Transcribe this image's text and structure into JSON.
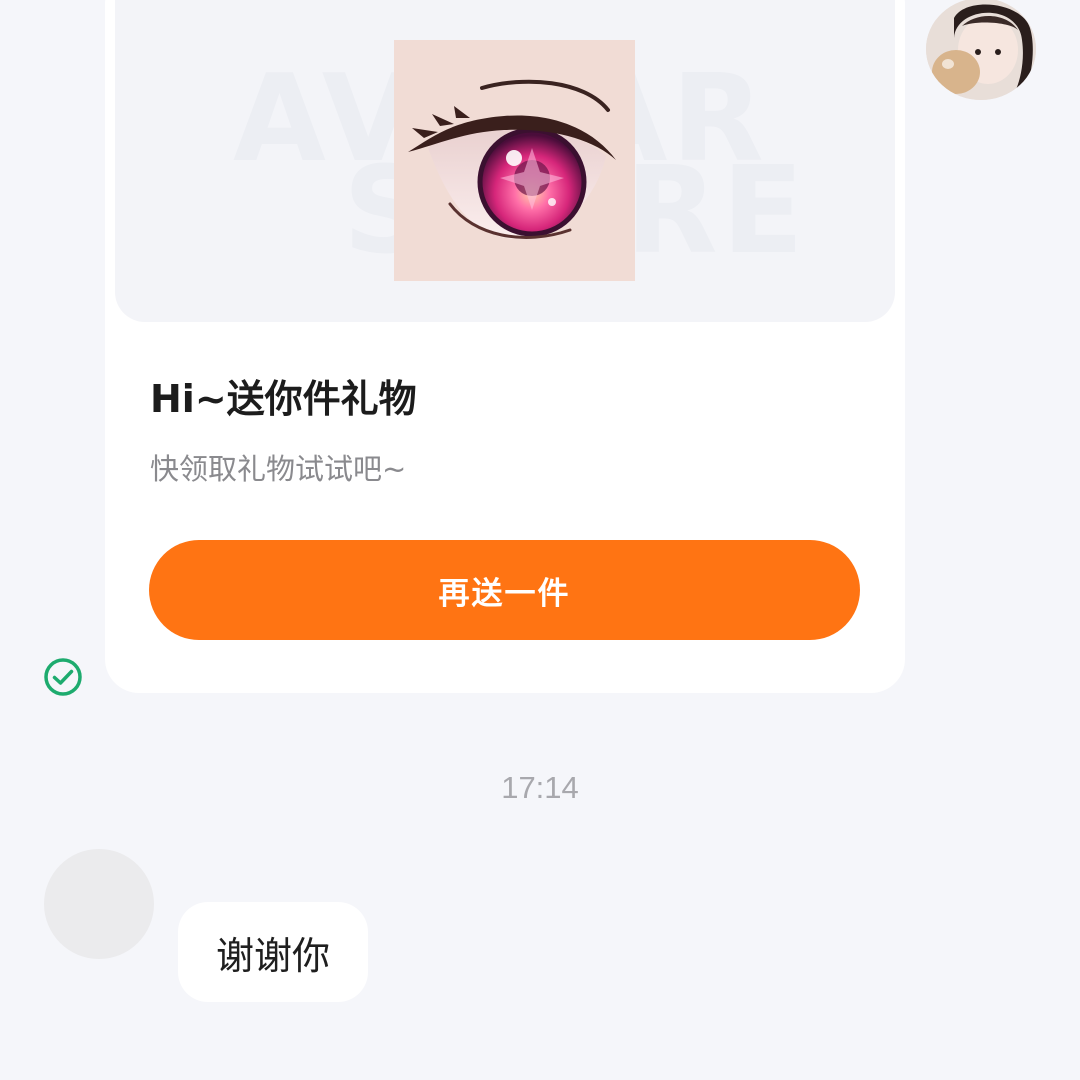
{
  "gift_card": {
    "watermark_line1": "AVATAR",
    "watermark_line2": "STORE",
    "image_icon": "anime-eye-icon",
    "title": "Hi~送你件礼物",
    "subtitle": "快领取礼物试试吧~",
    "button_label": "再送一件",
    "button_color": "#ff7413"
  },
  "status": {
    "read_icon": "check-circle-icon",
    "read_color": "#1dab6e"
  },
  "timestamp": "17:14",
  "incoming_message": {
    "text": "谢谢你"
  }
}
